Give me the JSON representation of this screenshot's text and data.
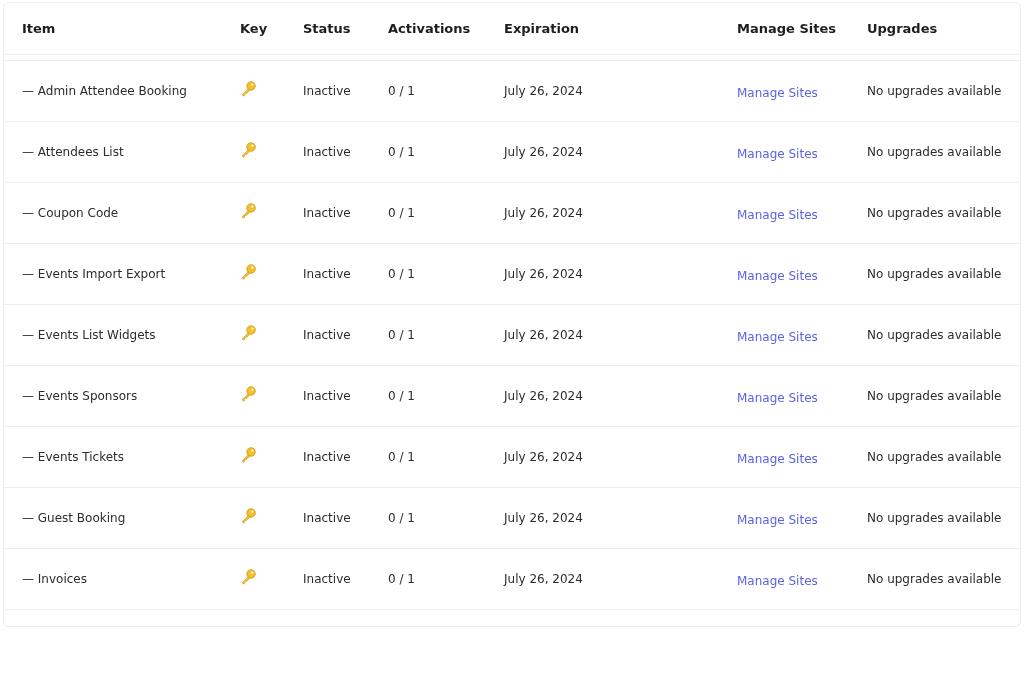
{
  "table": {
    "columns": [
      "Item",
      "Key",
      "Status",
      "Activations",
      "Expiration",
      "Manage Sites",
      "Upgrades"
    ],
    "rows": [
      {
        "item": "— Admin Attendee Booking",
        "status": "Inactive",
        "activations": "0 / 1",
        "expiration": "July 26, 2024",
        "manage": "Manage Sites",
        "upgrades": "No upgrades available"
      },
      {
        "item": "— Attendees List",
        "status": "Inactive",
        "activations": "0 / 1",
        "expiration": "July 26, 2024",
        "manage": "Manage Sites",
        "upgrades": "No upgrades available"
      },
      {
        "item": "— Coupon Code",
        "status": "Inactive",
        "activations": "0 / 1",
        "expiration": "July 26, 2024",
        "manage": "Manage Sites",
        "upgrades": "No upgrades available"
      },
      {
        "item": "— Events Import Export",
        "status": "Inactive",
        "activations": "0 / 1",
        "expiration": "July 26, 2024",
        "manage": "Manage Sites",
        "upgrades": "No upgrades available"
      },
      {
        "item": "— Events List Widgets",
        "status": "Inactive",
        "activations": "0 / 1",
        "expiration": "July 26, 2024",
        "manage": "Manage Sites",
        "upgrades": "No upgrades available"
      },
      {
        "item": "— Events Sponsors",
        "status": "Inactive",
        "activations": "0 / 1",
        "expiration": "July 26, 2024",
        "manage": "Manage Sites",
        "upgrades": "No upgrades available"
      },
      {
        "item": "— Events Tickets",
        "status": "Inactive",
        "activations": "0 / 1",
        "expiration": "July 26, 2024",
        "manage": "Manage Sites",
        "upgrades": "No upgrades available"
      },
      {
        "item": "— Guest Booking",
        "status": "Inactive",
        "activations": "0 / 1",
        "expiration": "July 26, 2024",
        "manage": "Manage Sites",
        "upgrades": "No upgrades available"
      },
      {
        "item": "— Invoices",
        "status": "Inactive",
        "activations": "0 / 1",
        "expiration": "July 26, 2024",
        "manage": "Manage Sites",
        "upgrades": "No upgrades available"
      }
    ]
  }
}
